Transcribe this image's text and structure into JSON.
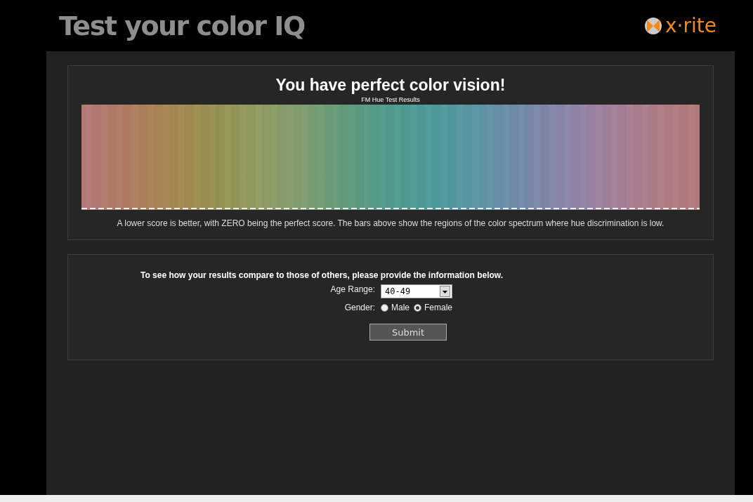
{
  "header": {
    "title": "Test your color IQ",
    "logo_text": "x·rite"
  },
  "results": {
    "heading": "You have perfect color vision!",
    "chart_caption": "FM Hue Test Results",
    "note": "A lower score is better, with ZERO being the perfect score. The bars above show the regions of the color spectrum where hue discrimination is low."
  },
  "compare": {
    "intro": "To see how your results compare to those of others, please provide the information below.",
    "age_label": "Age Range:",
    "age_value": "40-49",
    "gender_label": "Gender:",
    "genders": [
      {
        "label": "Male",
        "selected": false
      },
      {
        "label": "Female",
        "selected": true
      }
    ],
    "submit": "Submit"
  }
}
